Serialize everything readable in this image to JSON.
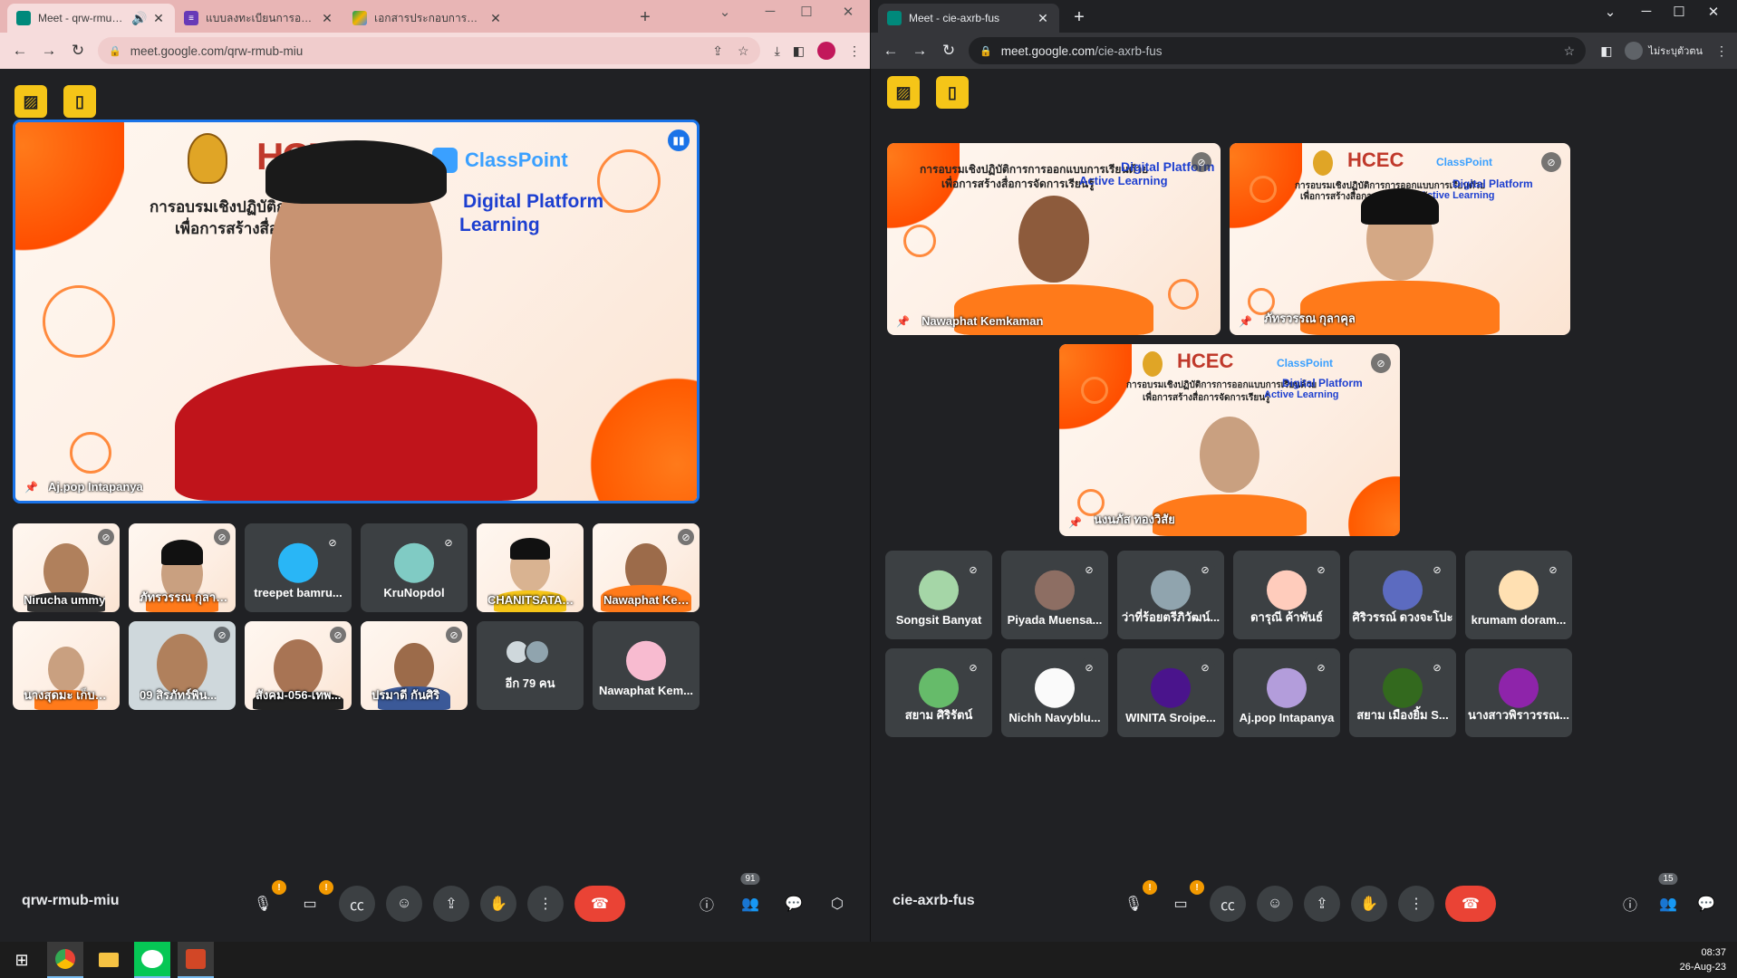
{
  "left_window": {
    "tabs": [
      {
        "title": "Meet - qrw-rmub-miu",
        "active": true,
        "audio": true
      },
      {
        "title": "แบบลงทะเบียนการอบรมเชิงปฏิบัติก",
        "active": false
      },
      {
        "title": "เอกสารประกอบการอบรม Digital P",
        "active": false
      }
    ],
    "url_host": "meet.google.com",
    "url_path": "/qrw-rmub-miu",
    "main_speaker": {
      "name": "Aj.pop Intapanya"
    },
    "slide": {
      "title_thai_1": "การอบรมเชิงปฏิบัติการ",
      "title_thai_2": "เพื่อการสร้างสื่อก",
      "dp": "Digital Platform",
      "al": "Learning",
      "classpoint": "ClassPoint",
      "hcec": "HCEC"
    },
    "grid": [
      {
        "name": "Nirucha ummy",
        "type": "video"
      },
      {
        "name": "ภัทรวรรณ กุลาคุล",
        "type": "video"
      },
      {
        "name": "treepet bamru...",
        "type": "avatar"
      },
      {
        "name": "KruNopdol",
        "type": "avatar"
      },
      {
        "name": "CHANITSATA K...",
        "type": "video"
      },
      {
        "name": "Nawaphat Kem...",
        "type": "video"
      },
      {
        "name": "นางสุดมะ เก็บทูกาน...",
        "type": "video"
      },
      {
        "name": "09 สิรภัทร์พิน...",
        "type": "video"
      },
      {
        "name": "สังคม-056-เทพ...",
        "type": "video"
      },
      {
        "name": "ปรมาดี กันศิริ",
        "type": "video"
      },
      {
        "name": "อีก 79 คน",
        "type": "more"
      },
      {
        "name": "Nawaphat Kem...",
        "type": "avatar"
      }
    ],
    "meeting_code": "qrw-rmub-miu",
    "participant_count": "91"
  },
  "right_window": {
    "tabs": [
      {
        "title": "Meet - cie-axrb-fus",
        "active": true
      }
    ],
    "url_host": "meet.google.com",
    "url_path": "/cie-axrb-fus",
    "profile_label": "ไม่ระบุตัวตน",
    "featured": [
      {
        "name": "Nawaphat Kemkaman"
      },
      {
        "name": "ภัทรวรรณ กุลาคุล"
      },
      {
        "name": "นงนภัส ทองวิสัย"
      }
    ],
    "slide": {
      "line1_th": "การอบรมเชิงปฏิบัติการการออกแบบการเรียนด้วย",
      "line1_en": "Digital Platform",
      "line2_th": "เพื่อการสร้างสื่อการจัดการเรียนรู้",
      "line2_en": "Active Learning",
      "classpoint": "ClassPoint",
      "hcec": "HCEC"
    },
    "grid": [
      {
        "name": "Songsit Banyat"
      },
      {
        "name": "Piyada Muensa..."
      },
      {
        "name": "ว่าที่ร้อยตรีภิวัฒน์..."
      },
      {
        "name": "ดารุณี ค้าพันธ์"
      },
      {
        "name": "ศิริวรรณ์ ดวงจะโปะ"
      },
      {
        "name": "krumam doram..."
      },
      {
        "name": "สยาม ศิริรัตน์"
      },
      {
        "name": "Nichh Navyblu..."
      },
      {
        "name": "WINITA Sroipe..."
      },
      {
        "name": "Aj.pop Intapanya"
      },
      {
        "name": "สยาม เมืองยิ้ม S..."
      },
      {
        "name": "นางสาวพิราวรรณ..."
      }
    ],
    "meeting_code": "cie-axrb-fus",
    "participant_count": "15"
  },
  "taskbar": {
    "time": "08:37",
    "date": "26-Aug-23"
  }
}
